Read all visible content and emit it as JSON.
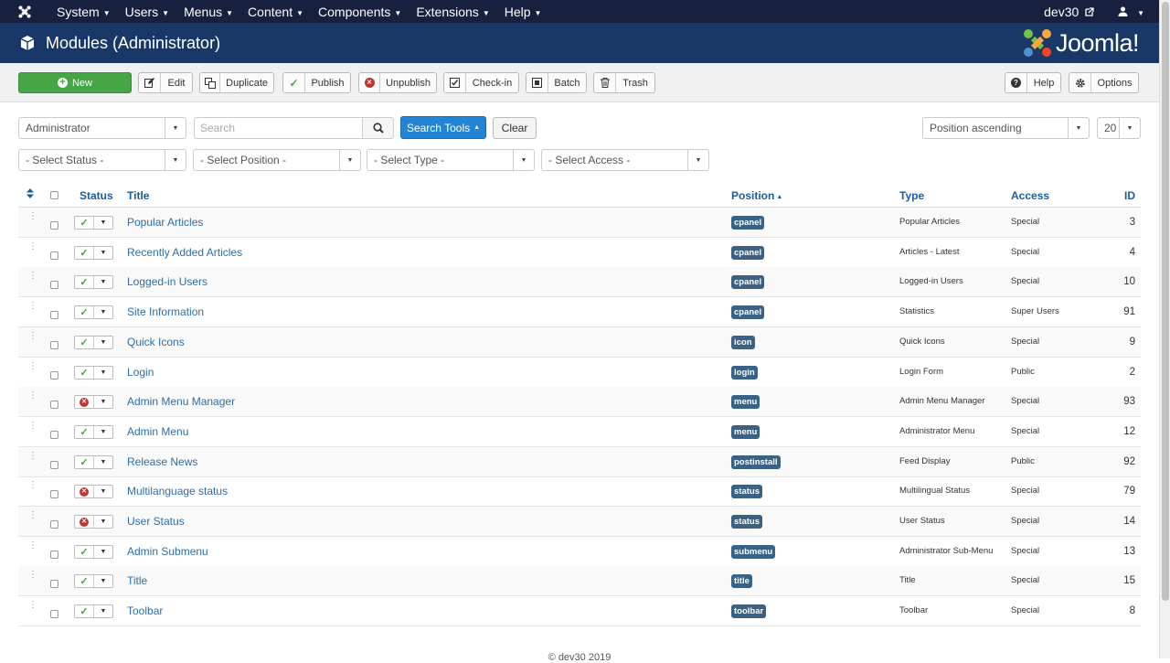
{
  "nav": {
    "menus": [
      "System",
      "Users",
      "Menus",
      "Content",
      "Components",
      "Extensions",
      "Help"
    ],
    "site_link": "dev30",
    "user_menu_icon": "user-icon"
  },
  "header": {
    "title": "Modules (Administrator)",
    "brand": "Joomla!"
  },
  "toolbar": {
    "new": "New",
    "edit": "Edit",
    "duplicate": "Duplicate",
    "publish": "Publish",
    "unpublish": "Unpublish",
    "checkin": "Check-in",
    "batch": "Batch",
    "trash": "Trash",
    "help": "Help",
    "options": "Options"
  },
  "filters": {
    "client": "Administrator",
    "search_placeholder": "Search",
    "search_tools": "Search Tools",
    "clear": "Clear",
    "ordering": "Position ascending",
    "limit": "20",
    "status": "- Select Status -",
    "position": "- Select Position -",
    "type": "- Select Type -",
    "access": "- Select Access -"
  },
  "table": {
    "headers": {
      "status": "Status",
      "title": "Title",
      "position": "Position",
      "type": "Type",
      "access": "Access",
      "id": "ID"
    },
    "rows": [
      {
        "title": "Popular Articles",
        "published": true,
        "position": "cpanel",
        "type": "Popular Articles",
        "access": "Special",
        "id": "3"
      },
      {
        "title": "Recently Added Articles",
        "published": true,
        "position": "cpanel",
        "type": "Articles - Latest",
        "access": "Special",
        "id": "4"
      },
      {
        "title": "Logged-in Users",
        "published": true,
        "position": "cpanel",
        "type": "Logged-in Users",
        "access": "Special",
        "id": "10"
      },
      {
        "title": "Site Information",
        "published": true,
        "position": "cpanel",
        "type": "Statistics",
        "access": "Super Users",
        "id": "91"
      },
      {
        "title": "Quick Icons",
        "published": true,
        "position": "icon",
        "type": "Quick Icons",
        "access": "Special",
        "id": "9"
      },
      {
        "title": "Login",
        "published": true,
        "position": "login",
        "type": "Login Form",
        "access": "Public",
        "id": "2"
      },
      {
        "title": "Admin Menu Manager",
        "published": false,
        "position": "menu",
        "type": "Admin Menu Manager",
        "access": "Special",
        "id": "93"
      },
      {
        "title": "Admin Menu",
        "published": true,
        "position": "menu",
        "type": "Administrator Menu",
        "access": "Special",
        "id": "12"
      },
      {
        "title": "Release News",
        "published": true,
        "position": "postinstall",
        "type": "Feed Display",
        "access": "Public",
        "id": "92"
      },
      {
        "title": "Multilanguage status",
        "published": false,
        "position": "status",
        "type": "Multilingual Status",
        "access": "Special",
        "id": "79"
      },
      {
        "title": "User Status",
        "published": false,
        "position": "status",
        "type": "User Status",
        "access": "Special",
        "id": "14"
      },
      {
        "title": "Admin Submenu",
        "published": true,
        "position": "submenu",
        "type": "Administrator Sub-Menu",
        "access": "Special",
        "id": "13"
      },
      {
        "title": "Title",
        "published": true,
        "position": "title",
        "type": "Title",
        "access": "Special",
        "id": "15"
      },
      {
        "title": "Toolbar",
        "published": true,
        "position": "toolbar",
        "type": "Toolbar",
        "access": "Special",
        "id": "8"
      }
    ]
  },
  "footer": "© dev30 2019",
  "colors": {
    "navbar": "#17213f",
    "header": "#1a3867",
    "new_button": "#46a546",
    "search_tools": "#2384d3",
    "position_badge": "#3a6186",
    "link": "#2f6ea6"
  }
}
